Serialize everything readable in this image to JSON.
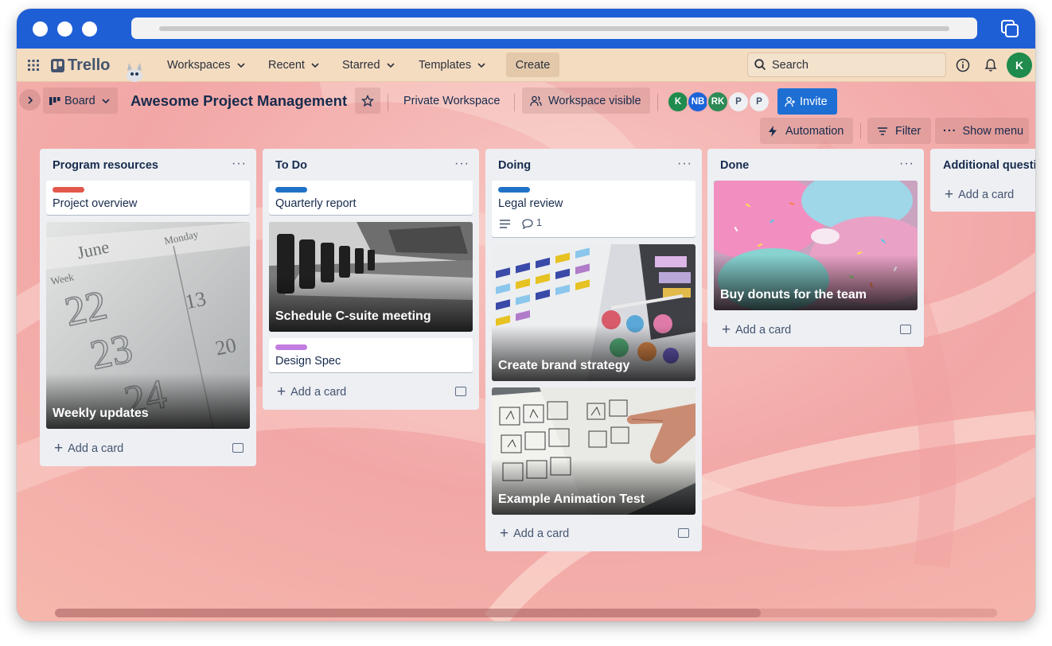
{
  "browser": {
    "traffic_lights": 3
  },
  "header": {
    "apps_icon": "grid-icon",
    "logo": "Trello",
    "nav": [
      {
        "label": "Workspaces"
      },
      {
        "label": "Recent"
      },
      {
        "label": "Starred"
      },
      {
        "label": "Templates"
      }
    ],
    "create_label": "Create",
    "search_placeholder": "Search",
    "user_initial": "K"
  },
  "board": {
    "view_label": "Board",
    "title": "Awesome Project Management",
    "workspace": "Private Workspace",
    "visibility": "Workspace visible",
    "members": [
      "K",
      "NB",
      "RK",
      "P",
      "P"
    ],
    "invite_label": "Invite",
    "automation_label": "Automation",
    "filter_label": "Filter",
    "menu_label": "Show menu"
  },
  "lists": [
    {
      "title": "Program resources",
      "cards": [
        {
          "title": "Project overview",
          "label_color": "#e2574c"
        },
        {
          "title": "Weekly updates",
          "cover": "calendar"
        }
      ]
    },
    {
      "title": "To Do",
      "cards": [
        {
          "title": "Quarterly report",
          "label_color": "#1f72c8"
        },
        {
          "title": "Schedule C-suite meeting",
          "cover": "meeting-room"
        },
        {
          "title": "Design Spec",
          "label_color": "#c27ce0"
        }
      ]
    },
    {
      "title": "Doing",
      "cards": [
        {
          "title": "Legal review",
          "label_color": "#1f72c8",
          "comments": "1"
        },
        {
          "title": "Create brand strategy",
          "cover": "color-swatches"
        },
        {
          "title": "Example Animation Test",
          "cover": "sketches"
        }
      ]
    },
    {
      "title": "Done",
      "cards": [
        {
          "title": "Buy donuts for the team",
          "cover": "donuts"
        }
      ]
    },
    {
      "title": "Additional questi",
      "cards": []
    }
  ],
  "add_card_label": "Add a card"
}
